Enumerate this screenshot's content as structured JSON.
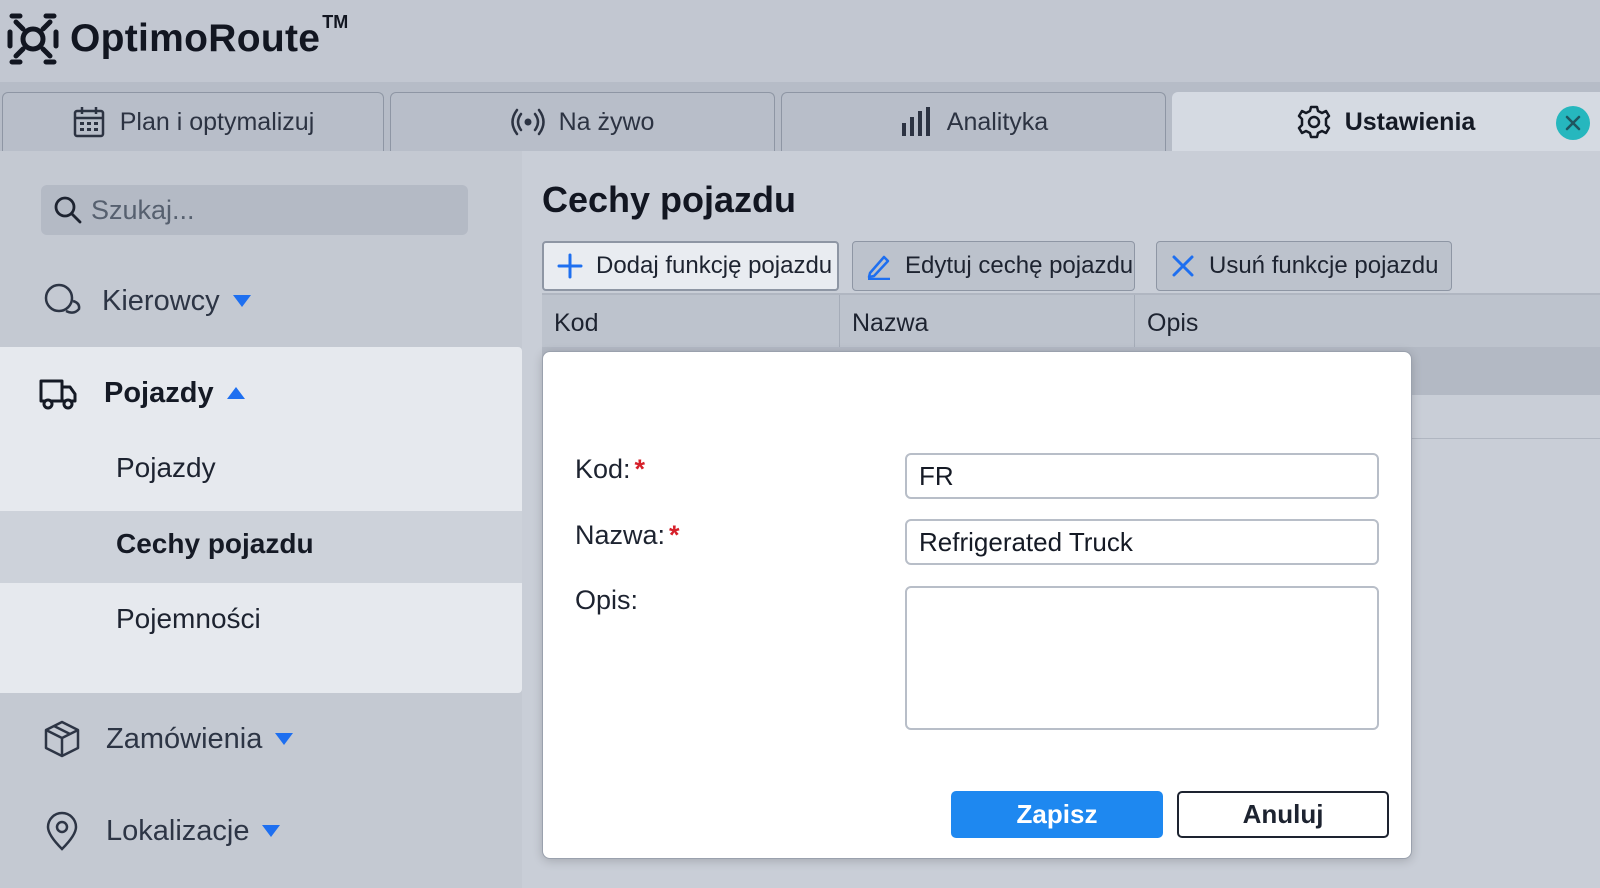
{
  "brand": {
    "name": "OptimoRoute",
    "tm": "TM"
  },
  "tabs": [
    {
      "label": "Plan i optymalizuj",
      "icon": "calendar-icon"
    },
    {
      "label": "Na żywo",
      "icon": "broadcast-icon"
    },
    {
      "label": "Analityka",
      "icon": "bar-chart-icon"
    },
    {
      "label": "Ustawienia",
      "icon": "gear-icon",
      "active": true
    }
  ],
  "sidebar": {
    "search_placeholder": "Szukaj...",
    "items": [
      {
        "label": "Kierowcy",
        "icon": "drivers-icon",
        "expanded": false
      },
      {
        "label": "Pojazdy",
        "icon": "truck-icon",
        "expanded": true,
        "children": [
          {
            "label": "Pojazdy"
          },
          {
            "label": "Cechy pojazdu",
            "selected": true
          },
          {
            "label": "Pojemności"
          }
        ]
      },
      {
        "label": "Zamówienia",
        "icon": "box-icon",
        "expanded": false
      },
      {
        "label": "Lokalizacje",
        "icon": "location-pin-icon",
        "expanded": false
      }
    ]
  },
  "main": {
    "title": "Cechy pojazdu",
    "toolbar": {
      "add_label": "Dodaj funkcję pojazdu",
      "edit_label": "Edytuj cechę pojazdu",
      "delete_label": "Usuń funkcje pojazdu"
    },
    "columns": [
      "Kod",
      "Nazwa",
      "Opis"
    ]
  },
  "dialog": {
    "code_label": "Kod:",
    "code_value": "FR",
    "name_label": "Nazwa:",
    "name_value": "Refrigerated Truck",
    "desc_label": "Opis:",
    "desc_value": "",
    "required_mark": "*",
    "save_label": "Zapisz",
    "cancel_label": "Anuluj"
  },
  "colors": {
    "accent": "#1e88f0",
    "close_button": "#26b7be",
    "required": "#d6202a"
  }
}
